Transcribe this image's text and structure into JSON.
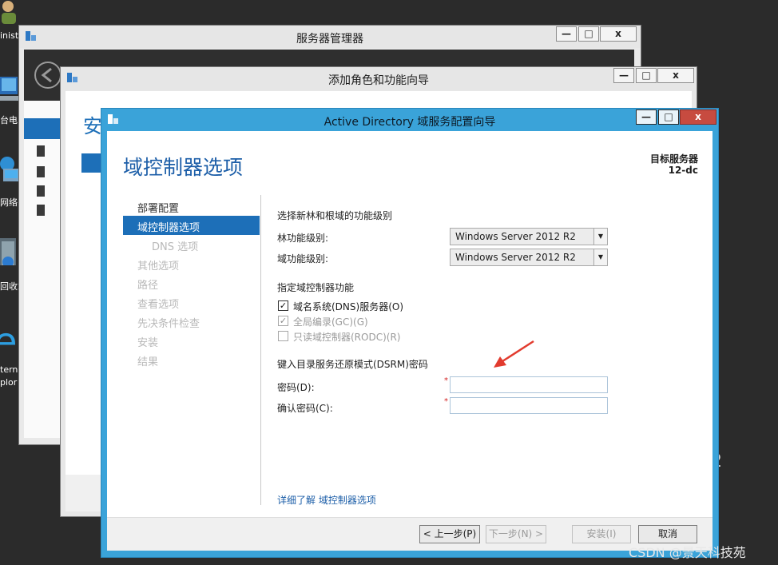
{
  "desktop": {
    "icons": [
      {
        "name": "user-icon",
        "label": "inist"
      },
      {
        "name": "computer-icon",
        "label": "台电"
      },
      {
        "name": "network-icon",
        "label": "网络"
      },
      {
        "name": "recycle-bin-icon",
        "label": "回收站"
      },
      {
        "name": "ie-icon",
        "label_line1": "terne",
        "label_line2": "plor"
      }
    ],
    "partial_digit": "2"
  },
  "server_manager": {
    "title": "服务器管理器",
    "buttons": {
      "min": "—",
      "max": "□",
      "close": "x"
    }
  },
  "add_roles_wizard": {
    "title": "添加角色和功能向导",
    "heading_partial": "安",
    "buttons": {
      "min": "—",
      "max": "□",
      "close": "x"
    }
  },
  "adds_wizard": {
    "title": "Active Directory 域服务配置向导",
    "buttons": {
      "min": "—",
      "max": "□",
      "close": "x"
    },
    "page_title": "域控制器选项",
    "target_server_label": "目标服务器",
    "target_server_value": "12-dc",
    "steps": [
      {
        "label": "部署配置",
        "state": "done"
      },
      {
        "label": "域控制器选项",
        "state": "current"
      },
      {
        "label": "DNS 选项",
        "state": "disabled"
      },
      {
        "label": "其他选项",
        "state": "disabled"
      },
      {
        "label": "路径",
        "state": "disabled"
      },
      {
        "label": "查看选项",
        "state": "disabled"
      },
      {
        "label": "先决条件检查",
        "state": "disabled"
      },
      {
        "label": "安装",
        "state": "disabled"
      },
      {
        "label": "结果",
        "state": "disabled"
      }
    ],
    "functional_level_heading": "选择新林和根域的功能级别",
    "forest_level_label": "林功能级别:",
    "forest_level_value": "Windows Server 2012 R2",
    "domain_level_label": "域功能级别:",
    "domain_level_value": "Windows Server 2012 R2",
    "dc_capabilities_heading": "指定域控制器功能",
    "capabilities": [
      {
        "label": "域名系统(DNS)服务器(O)",
        "checked": true,
        "enabled": true
      },
      {
        "label": "全局编录(GC)(G)",
        "checked": true,
        "enabled": false
      },
      {
        "label": "只读域控制器(RODC)(R)",
        "checked": false,
        "enabled": false
      }
    ],
    "dsrm_heading": "键入目录服务还原模式(DSRM)密码",
    "password_label": "密码(D):",
    "confirm_password_label": "确认密码(C):",
    "password_value": "",
    "confirm_password_value": "",
    "required_marker": "*",
    "learn_more_link": "详细了解 域控制器选项",
    "nav_buttons": {
      "back": "< 上一步(P)",
      "next": "下一步(N) >",
      "install": "安装(I)",
      "cancel": "取消"
    },
    "checkmark": "✓"
  },
  "watermark": "CSDN @景天科技苑",
  "colors": {
    "accent": "#1d6fb8",
    "titlebar_active": "#3aa3d9",
    "close_button": "#c74b40",
    "required": "#d21f1f",
    "annotation_arrow": "#e23b2e"
  }
}
